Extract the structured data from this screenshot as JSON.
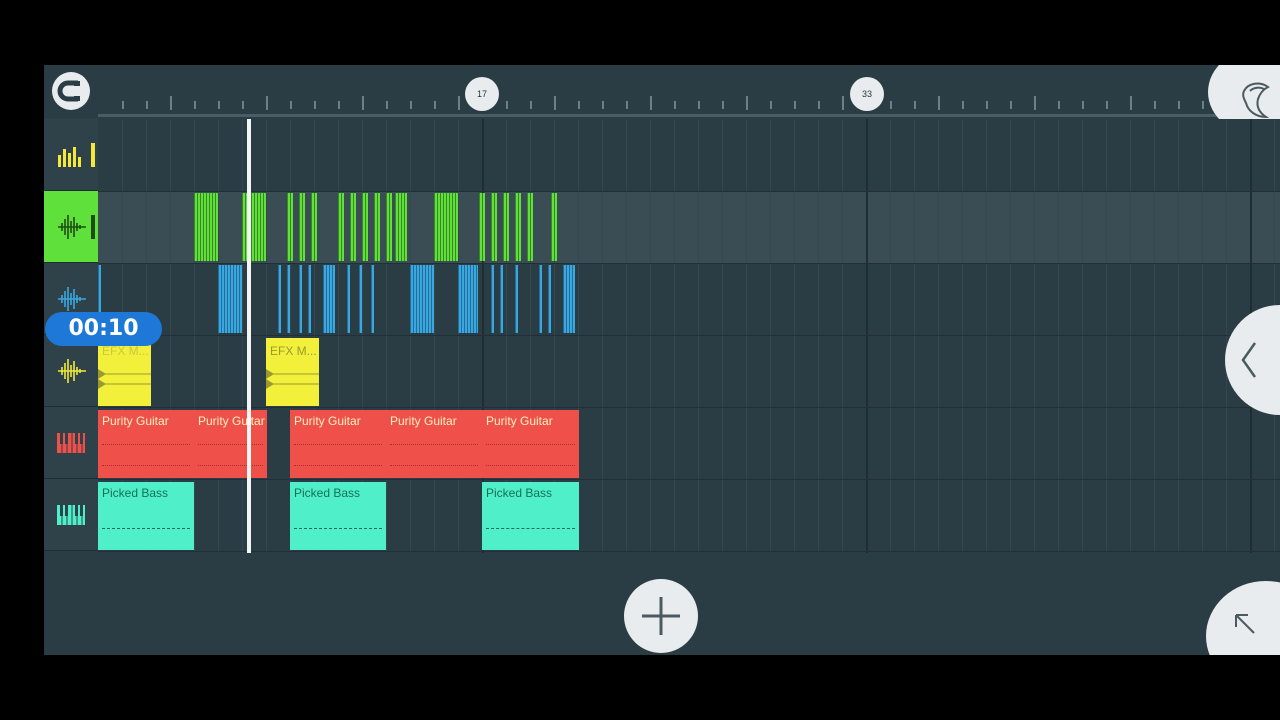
{
  "ruler": {
    "markers": [
      "17",
      "33"
    ]
  },
  "time": {
    "current": "00:10"
  },
  "tracks": [
    {
      "icon": "mixer-bars-icon",
      "color": "#f2e93a"
    },
    {
      "icon": "audio-wave-icon",
      "color": "#5fe03a"
    },
    {
      "icon": "audio-wave-icon",
      "color": "#3aa8e0"
    },
    {
      "icon": "audio-wave-icon",
      "color": "#f2e93a"
    },
    {
      "icon": "piano-keys-icon",
      "color": "#f0504a"
    },
    {
      "icon": "piano-keys-icon",
      "color": "#4ff0c9"
    }
  ],
  "clips": {
    "efx": [
      "EFX M...",
      "EFX M..."
    ],
    "guitar": [
      "Purity Guitar",
      "Purity Guitar",
      "Purity Guitar",
      "Purity Guitar",
      "Purity Guitar"
    ],
    "bass": [
      "Picked Bass",
      "Picked Bass",
      "Picked Bass"
    ]
  },
  "colors": {
    "green": "#5fe03a",
    "blue": "#3aa8e0",
    "yellow": "#f2f03a",
    "red": "#f0504a",
    "teal": "#4ff0c9",
    "badge": "#1e78d8"
  }
}
